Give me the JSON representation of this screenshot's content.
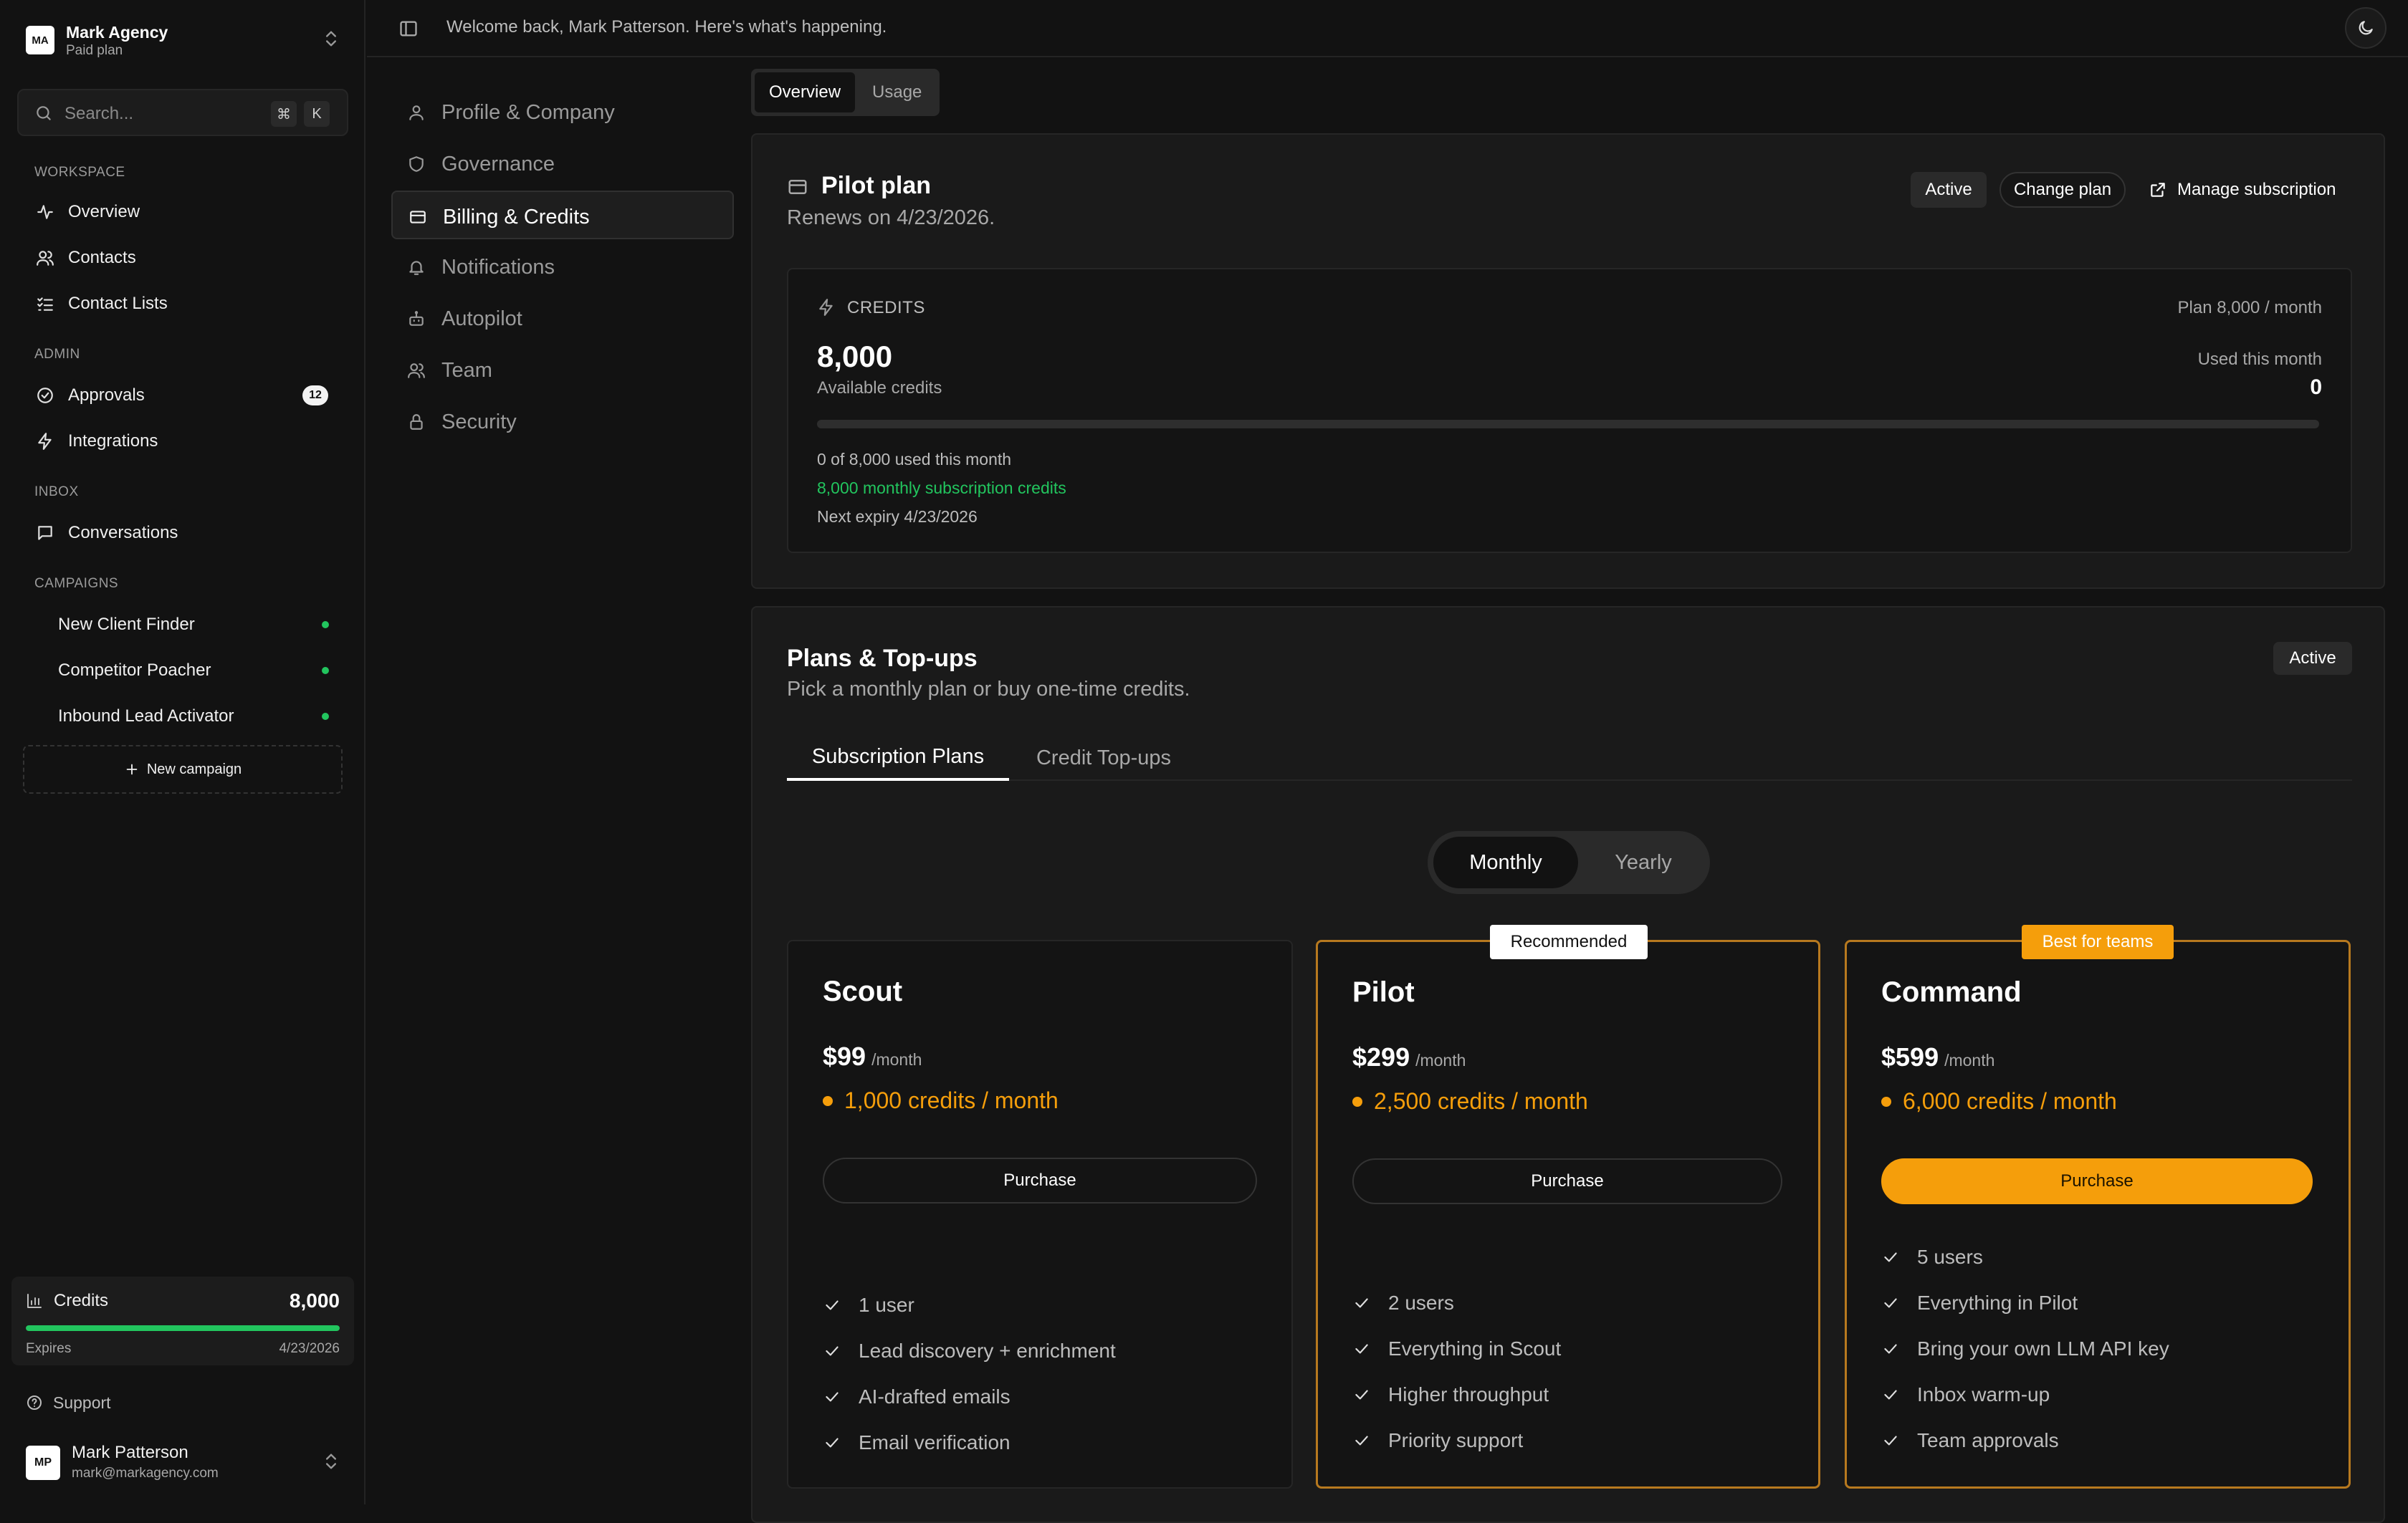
{
  "org": {
    "initials": "MA",
    "name": "Mark Agency",
    "plan": "Paid plan"
  },
  "search": {
    "placeholder": "Search...",
    "key1": "⌘",
    "key2": "K"
  },
  "sidebar": {
    "workspace_label": "WORKSPACE",
    "workspace": [
      {
        "label": "Overview",
        "icon": "activity-icon"
      },
      {
        "label": "Contacts",
        "icon": "users-icon"
      },
      {
        "label": "Contact Lists",
        "icon": "list-checks-icon"
      }
    ],
    "admin_label": "ADMIN",
    "admin": [
      {
        "label": "Approvals",
        "icon": "check-circle-icon",
        "badge": "12"
      },
      {
        "label": "Integrations",
        "icon": "zap-icon"
      }
    ],
    "inbox_label": "INBOX",
    "inbox": [
      {
        "label": "Conversations",
        "icon": "message-square-icon"
      }
    ],
    "campaigns_label": "CAMPAIGNS",
    "campaigns": [
      {
        "label": "New Client Finder",
        "status_color": "#22c55e"
      },
      {
        "label": "Competitor Poacher",
        "status_color": "#22c55e"
      },
      {
        "label": "Inbound Lead Activator",
        "status_color": "#22c55e"
      }
    ],
    "new_campaign": "New campaign",
    "credits": {
      "title": "Credits",
      "value": "8,000",
      "fill_fraction": 1.0,
      "expires_label": "Expires",
      "expires_date": "4/23/2026"
    },
    "support": "Support",
    "user": {
      "initials": "MP",
      "name": "Mark Patterson",
      "email": "mark@markagency.com"
    }
  },
  "topbar": {
    "welcome": "Welcome back, Mark Patterson. Here's what's happening."
  },
  "settings_nav": [
    {
      "label": "Profile & Company",
      "icon": "user-icon",
      "active": false
    },
    {
      "label": "Governance",
      "icon": "shield-icon",
      "active": false
    },
    {
      "label": "Billing & Credits",
      "icon": "credit-card-icon",
      "active": true
    },
    {
      "label": "Notifications",
      "icon": "bell-icon",
      "active": false
    },
    {
      "label": "Autopilot",
      "icon": "bot-icon",
      "active": false
    },
    {
      "label": "Team",
      "icon": "users-icon",
      "active": false
    },
    {
      "label": "Security",
      "icon": "lock-icon",
      "active": false
    }
  ],
  "view_tabs": {
    "overview": "Overview",
    "usage": "Usage",
    "selected": "Overview"
  },
  "plan_card": {
    "title": "Pilot plan",
    "renews": "Renews on 4/23/2026.",
    "status": "Active",
    "change_plan": "Change plan",
    "manage": "Manage subscription",
    "credits": {
      "label": "CREDITS",
      "plan_text": "Plan 8,000 / month",
      "available": "8,000",
      "available_label": "Available credits",
      "used_label": "Used this month",
      "used_value": "0",
      "used_fraction": 0,
      "line1": "0 of 8,000 used this month",
      "line2": "8,000 monthly subscription credits",
      "line3": "Next expiry 4/23/2026"
    }
  },
  "plans": {
    "title": "Plans & Top-ups",
    "subtitle": "Pick a monthly plan or buy one-time credits.",
    "status": "Active",
    "tabs": [
      "Subscription Plans",
      "Credit Top-ups"
    ],
    "billing_toggle": [
      "Monthly",
      "Yearly"
    ],
    "accent": "#f59e0b",
    "cards": [
      {
        "name": "Scout",
        "price": "$99",
        "per": "/month",
        "credits": "1,000 credits / month",
        "button": "Purchase",
        "features": [
          "1 user",
          "Lead discovery + enrichment",
          "AI-drafted emails",
          "Email verification"
        ]
      },
      {
        "name": "Pilot",
        "price": "$299",
        "per": "/month",
        "credits": "2,500 credits / month",
        "button": "Purchase",
        "ribbon": "Recommended",
        "features": [
          "2 users",
          "Everything in Scout",
          "Higher throughput",
          "Priority support"
        ]
      },
      {
        "name": "Command",
        "price": "$599",
        "per": "/month",
        "credits": "6,000 credits / month",
        "button": "Purchase",
        "ribbon": "Best for teams",
        "features": [
          "5 users",
          "Everything in Pilot",
          "Bring your own LLM API key",
          "Inbox warm-up",
          "Team approvals"
        ]
      }
    ]
  }
}
